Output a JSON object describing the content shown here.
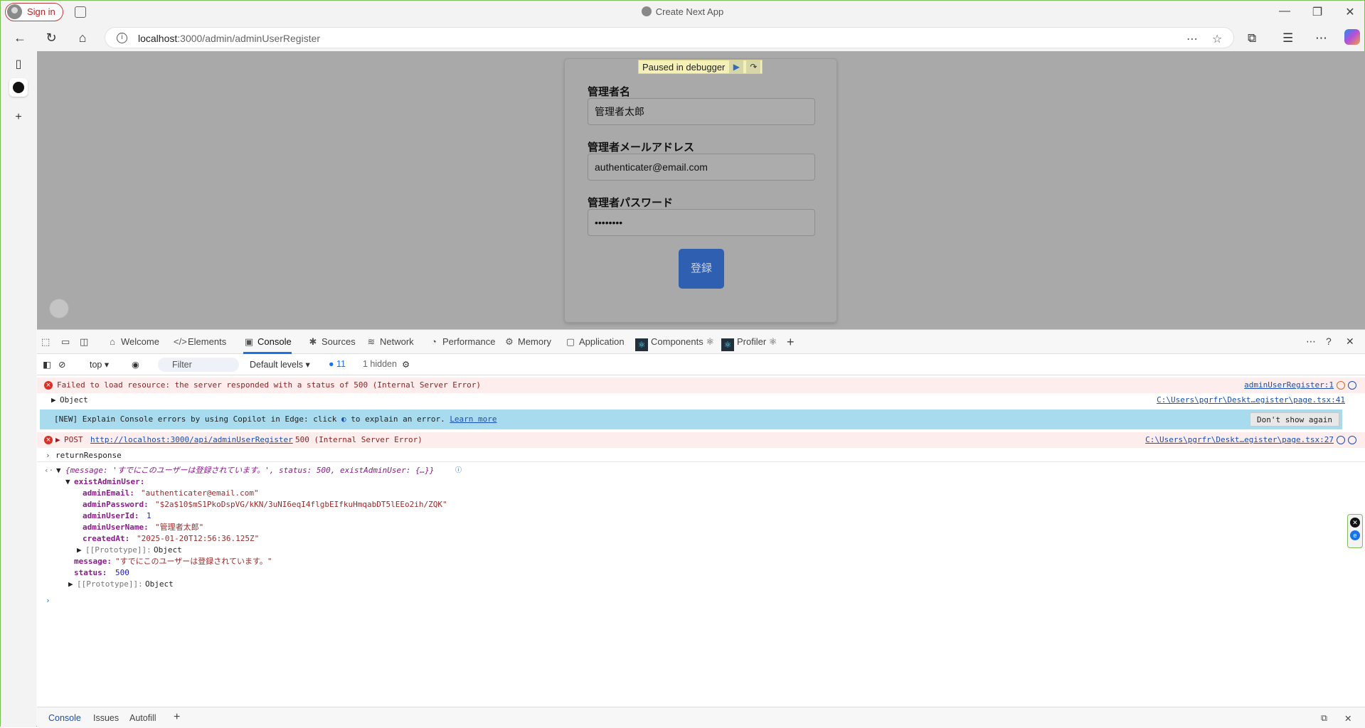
{
  "browser": {
    "sign_in": "Sign in",
    "window_title": "Create Next App",
    "url_host": "localhost",
    "url_path": ":3000/admin/adminUserRegister"
  },
  "page": {
    "debugger_banner": "Paused in debugger",
    "admin_name_label": "管理者名",
    "admin_name_value": "管理者太郎",
    "admin_email_label": "管理者メールアドレス",
    "admin_email_value": "authenticater@email.com",
    "admin_password_label": "管理者パスワード",
    "admin_password_value": "••••••••",
    "submit_label": "登録"
  },
  "devtools": {
    "tabs": [
      "Welcome",
      "Elements",
      "Console",
      "Sources",
      "Network",
      "Performance",
      "Memory",
      "Application",
      "Components ⚛",
      "Profiler ⚛"
    ],
    "toolbar": {
      "context": "top",
      "filter_placeholder": "Filter",
      "levels": "Default levels",
      "message_count": "11",
      "hidden": "1 hidden"
    },
    "console": {
      "error1": "Failed to load resource: the server responded with a status of 500 (Internal Server Error)",
      "error1_src": "adminUserRegister:1",
      "object_label": "Object",
      "object_src": "C:\\Users\\pgrfr\\Deskt…egister\\page.tsx:41",
      "info_text": "[NEW] Explain Console errors by using Copilot in Edge: click",
      "info_text2": "to explain an error.",
      "info_link": "Learn more",
      "dont_show": "Don't show again",
      "post_prefix": "POST",
      "post_url": "http://localhost:3000/api/adminUserRegister",
      "post_suffix": "500 (Internal Server Error)",
      "post_src": "C:\\Users\\pgrfr\\Deskt…egister\\page.tsx:27",
      "return_label": "returnResponse",
      "summary": "{message: 'すでにこのユーザーは登録されています。', status: 500, existAdminUser: {…}}",
      "exist_key": "existAdminUser:",
      "email_key": "adminEmail:",
      "email_val": "\"authenticater@email.com\"",
      "password_key": "adminPassword:",
      "password_val": "\"$2a$10$mS1PkoDspVG/kKN/3uNI6eqI4flgbEIfkuHmqabDT5lEEo2ih/ZQK\"",
      "id_key": "adminUserId:",
      "id_val": "1",
      "username_key": "adminUserName:",
      "username_val": "\"管理者太郎\"",
      "created_key": "createdAt:",
      "created_val": "\"2025-01-20T12:56:36.125Z\"",
      "proto_key": "[[Prototype]]:",
      "proto_val": "Object",
      "message_key": "message:",
      "message_val": "\"すでにこのユーザーは登録されています。\"",
      "status_key": "status:",
      "status_val": "500"
    },
    "bottom_tabs": [
      "Console",
      "Issues",
      "Autofill"
    ]
  }
}
